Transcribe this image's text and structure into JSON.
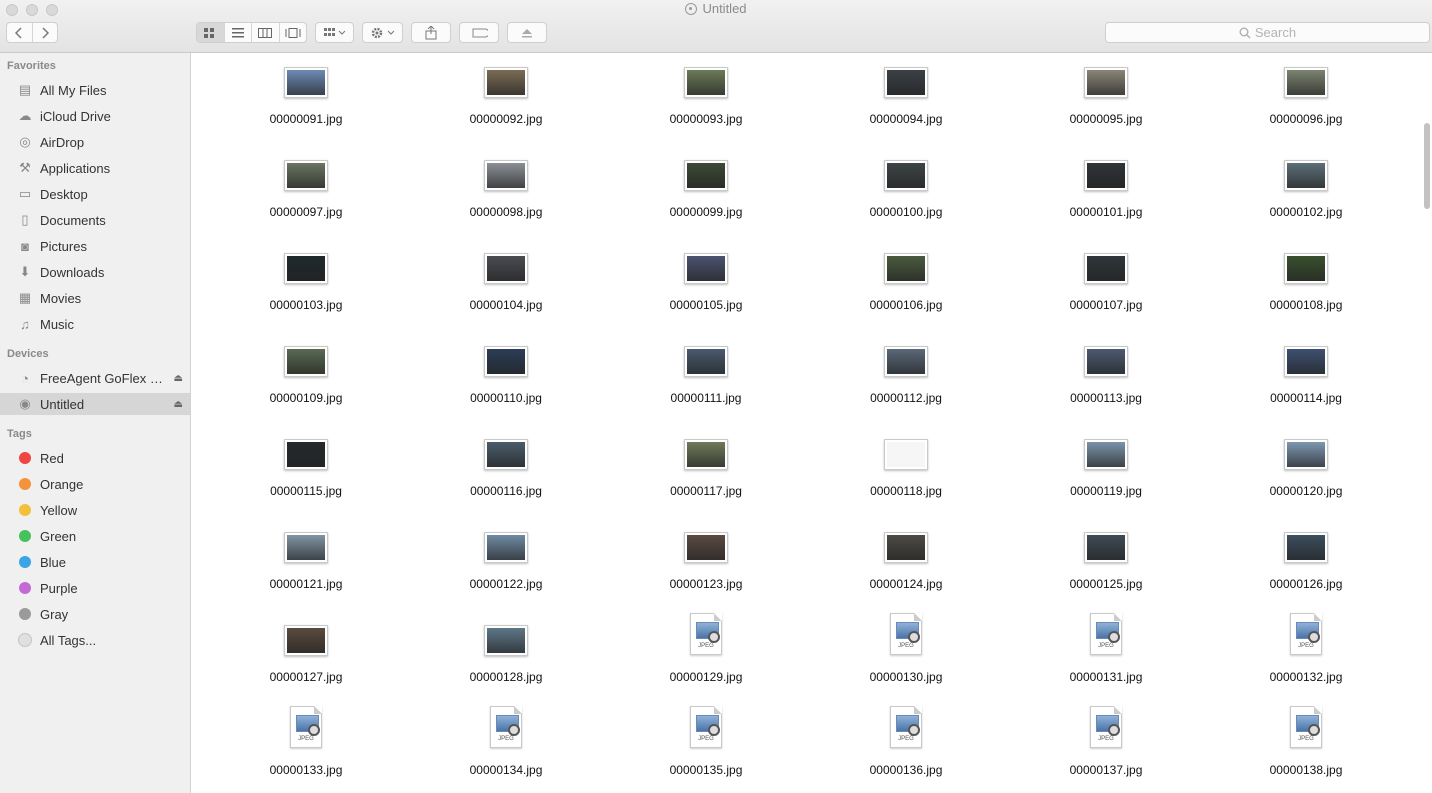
{
  "window": {
    "title": "Untitled"
  },
  "toolbar": {
    "search_placeholder": "Search",
    "back_icon": "chevron-left-icon",
    "forward_icon": "chevron-right-icon"
  },
  "sidebar": {
    "favorites_heading": "Favorites",
    "favorites": [
      {
        "label": "All My Files",
        "icon": "all-files-icon"
      },
      {
        "label": "iCloud Drive",
        "icon": "cloud-icon"
      },
      {
        "label": "AirDrop",
        "icon": "airdrop-icon"
      },
      {
        "label": "Applications",
        "icon": "applications-icon"
      },
      {
        "label": "Desktop",
        "icon": "desktop-icon"
      },
      {
        "label": "Documents",
        "icon": "documents-icon"
      },
      {
        "label": "Pictures",
        "icon": "camera-icon"
      },
      {
        "label": "Downloads",
        "icon": "download-icon"
      },
      {
        "label": "Movies",
        "icon": "film-icon"
      },
      {
        "label": "Music",
        "icon": "music-icon"
      }
    ],
    "devices_heading": "Devices",
    "devices": [
      {
        "label": "FreeAgent GoFlex Drive",
        "icon": "external-drive-icon",
        "selected": false
      },
      {
        "label": "Untitled",
        "icon": "disc-icon",
        "selected": true
      }
    ],
    "tags_heading": "Tags",
    "tags": [
      {
        "label": "Red",
        "color": "#f04545"
      },
      {
        "label": "Orange",
        "color": "#f4933a"
      },
      {
        "label": "Yellow",
        "color": "#f2c13c"
      },
      {
        "label": "Green",
        "color": "#47c15b"
      },
      {
        "label": "Blue",
        "color": "#3aa4e6"
      },
      {
        "label": "Purple",
        "color": "#c36ad6"
      },
      {
        "label": "Gray",
        "color": "#9a9a9a"
      },
      {
        "label": "All Tags...",
        "color": "#e0e0e0"
      }
    ]
  },
  "files": [
    {
      "name": "00000091.jpg",
      "kind": "thumb",
      "color": "#6d8ab5"
    },
    {
      "name": "00000092.jpg",
      "kind": "thumb",
      "color": "#7a6b55"
    },
    {
      "name": "00000093.jpg",
      "kind": "thumb",
      "color": "#6b7a58"
    },
    {
      "name": "00000094.jpg",
      "kind": "thumb",
      "color": "#3a4046"
    },
    {
      "name": "00000095.jpg",
      "kind": "thumb",
      "color": "#8a8577"
    },
    {
      "name": "00000096.jpg",
      "kind": "thumb",
      "color": "#7b8370"
    },
    {
      "name": "00000097.jpg",
      "kind": "thumb",
      "color": "#6a7562"
    },
    {
      "name": "00000098.jpg",
      "kind": "thumb",
      "color": "#8c9096"
    },
    {
      "name": "00000099.jpg",
      "kind": "thumb",
      "color": "#3b4a35"
    },
    {
      "name": "00000100.jpg",
      "kind": "thumb",
      "color": "#3e4446"
    },
    {
      "name": "00000101.jpg",
      "kind": "thumb",
      "color": "#2e3437"
    },
    {
      "name": "00000102.jpg",
      "kind": "thumb",
      "color": "#5d6f78"
    },
    {
      "name": "00000103.jpg",
      "kind": "thumb",
      "color": "#1f292c"
    },
    {
      "name": "00000104.jpg",
      "kind": "thumb",
      "color": "#4a4c52"
    },
    {
      "name": "00000105.jpg",
      "kind": "thumb",
      "color": "#4d5370"
    },
    {
      "name": "00000106.jpg",
      "kind": "thumb",
      "color": "#4a5a3e"
    },
    {
      "name": "00000107.jpg",
      "kind": "thumb",
      "color": "#2f363b"
    },
    {
      "name": "00000108.jpg",
      "kind": "thumb",
      "color": "#39502e"
    },
    {
      "name": "00000109.jpg",
      "kind": "thumb",
      "color": "#5a6a52"
    },
    {
      "name": "00000110.jpg",
      "kind": "thumb",
      "color": "#2b3d55"
    },
    {
      "name": "00000111.jpg",
      "kind": "thumb",
      "color": "#4a5a6e"
    },
    {
      "name": "00000112.jpg",
      "kind": "thumb",
      "color": "#5a6878"
    },
    {
      "name": "00000113.jpg",
      "kind": "thumb",
      "color": "#4c5a70"
    },
    {
      "name": "00000114.jpg",
      "kind": "thumb",
      "color": "#3d5070"
    },
    {
      "name": "00000115.jpg",
      "kind": "thumb",
      "color": "#25292c"
    },
    {
      "name": "00000116.jpg",
      "kind": "thumb",
      "color": "#4a5c6a"
    },
    {
      "name": "00000117.jpg",
      "kind": "thumb",
      "color": "#6e7a5a"
    },
    {
      "name": "00000118.jpg",
      "kind": "thumb",
      "color": "#f3f3f3"
    },
    {
      "name": "00000119.jpg",
      "kind": "thumb",
      "color": "#7a93a8"
    },
    {
      "name": "00000120.jpg",
      "kind": "thumb",
      "color": "#7d97b0"
    },
    {
      "name": "00000121.jpg",
      "kind": "thumb",
      "color": "#8095a5"
    },
    {
      "name": "00000122.jpg",
      "kind": "thumb",
      "color": "#6f8aa3"
    },
    {
      "name": "00000123.jpg",
      "kind": "thumb",
      "color": "#5a4a42"
    },
    {
      "name": "00000124.jpg",
      "kind": "thumb",
      "color": "#4d4a44"
    },
    {
      "name": "00000125.jpg",
      "kind": "thumb",
      "color": "#3f4a55"
    },
    {
      "name": "00000126.jpg",
      "kind": "thumb",
      "color": "#3c4e5e"
    },
    {
      "name": "00000127.jpg",
      "kind": "thumb",
      "color": "#5a4a3e"
    },
    {
      "name": "00000128.jpg",
      "kind": "thumb",
      "color": "#5e7788"
    },
    {
      "name": "00000129.jpg",
      "kind": "doc",
      "label": "JPEG"
    },
    {
      "name": "00000130.jpg",
      "kind": "doc",
      "label": "JPEG"
    },
    {
      "name": "00000131.jpg",
      "kind": "doc",
      "label": "JPEG"
    },
    {
      "name": "00000132.jpg",
      "kind": "doc",
      "label": "JPEG"
    },
    {
      "name": "00000133.jpg",
      "kind": "doc",
      "label": "JPEG"
    },
    {
      "name": "00000134.jpg",
      "kind": "doc",
      "label": "JPEG"
    },
    {
      "name": "00000135.jpg",
      "kind": "doc",
      "label": "JPEG"
    },
    {
      "name": "00000136.jpg",
      "kind": "doc",
      "label": "JPEG"
    },
    {
      "name": "00000137.jpg",
      "kind": "doc",
      "label": "JPEG"
    },
    {
      "name": "00000138.jpg",
      "kind": "doc",
      "label": "JPEG"
    }
  ]
}
